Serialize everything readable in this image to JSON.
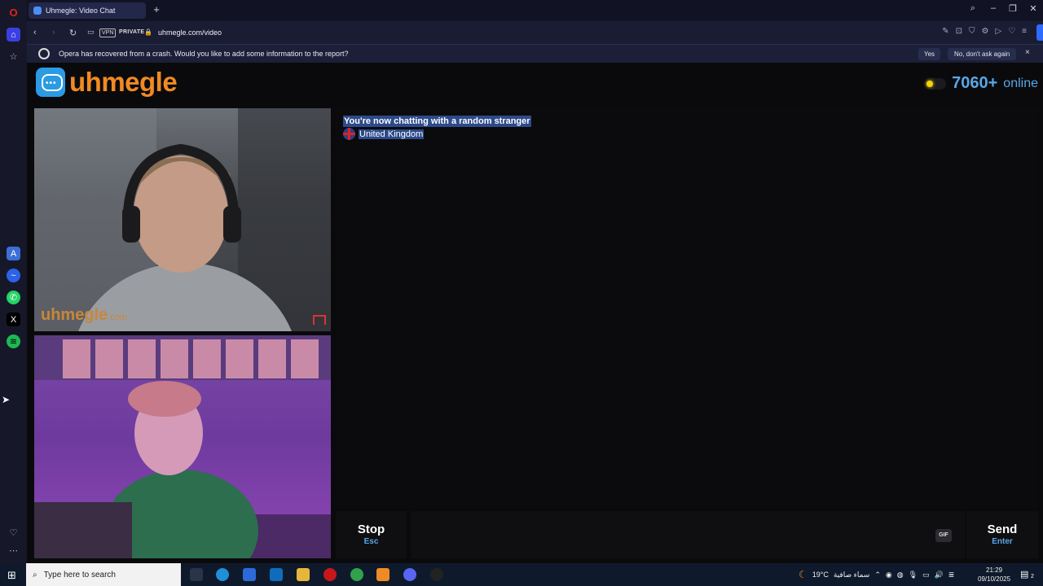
{
  "browser": {
    "tab_title": "Uhmegle: Video Chat",
    "new_tab_symbol": "+",
    "vpn_label": "VPN",
    "private_label": "PRIVATE",
    "url": "uhmegle.com/video"
  },
  "infobar": {
    "message": "Opera has recovered from a crash. Would you like to add some information to the report?",
    "yes_label": "Yes",
    "no_label": "No, don't ask again",
    "close_symbol": "×"
  },
  "site": {
    "logo_text": "uhmegle",
    "online_count": "7060+",
    "online_label": "online",
    "accent_color": "#f08a24",
    "info_color": "#5aa7e6"
  },
  "videos": {
    "watermark": "uhmegle",
    "watermark_suffix": ".com"
  },
  "chat": {
    "system_message": "You're now chatting with a random stranger",
    "stranger_country": "United Kingdom"
  },
  "controls": {
    "stop_label": "Stop",
    "stop_hint": "Esc",
    "gif_label": "GIF",
    "send_label": "Send",
    "send_hint": "Enter",
    "message_value": ""
  },
  "taskbar": {
    "search_placeholder": "Type here to search",
    "weather_temp": "19°C",
    "weather_desc": "سماء صافية",
    "time": "21:29",
    "date": "09/10/2025",
    "notification_count": "2"
  }
}
